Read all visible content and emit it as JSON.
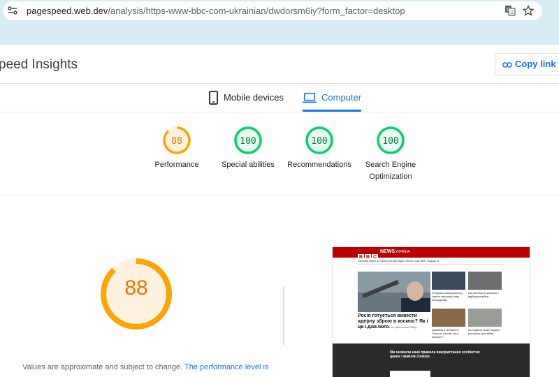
{
  "browser": {
    "url_host": "pagespeed.web.dev",
    "url_path": "/analysis/https-www-bbc-com-ukrainian/dwdorsm6iy?form_factor=desktop",
    "icons": [
      "site-info-icon",
      "translate-icon",
      "star-icon"
    ]
  },
  "header": {
    "title": "peed Insights",
    "copy_link_label": "Copy link"
  },
  "tabs": [
    {
      "label": "Mobile devices",
      "icon": "phone-icon",
      "active": false
    },
    {
      "label": "Computer",
      "icon": "laptop-icon",
      "active": true
    }
  ],
  "scores": [
    {
      "value": "88",
      "label": "Performance",
      "status": "average",
      "color": "#e67700",
      "ring": "#ffa400",
      "fraction": 0.88
    },
    {
      "value": "100",
      "label": "Special abilities",
      "status": "good",
      "color": "#0c7a3e",
      "ring": "#0cce6b",
      "fraction": 1.0
    },
    {
      "value": "100",
      "label": "Recommendations",
      "status": "good",
      "color": "#0c7a3e",
      "ring": "#0cce6b",
      "fraction": 1.0
    },
    {
      "value": "100",
      "label": "Search Engine Optimization",
      "status": "good",
      "color": "#0c7a3e",
      "ring": "#0cce6b",
      "fraction": 1.0
    }
  ],
  "performance": {
    "score": "88",
    "fraction": 0.88,
    "note_text": "Values are approximate and subject to change.",
    "note_link": "The performance level is"
  },
  "thumbnail": {
    "brand": [
      "B",
      "B",
      "C"
    ],
    "news": "NEWS",
    "edition": "УКРАЇНА",
    "nav": "Головна   Війна в Україні   Історії   Відео   Книги року ВВС   Подкасти",
    "headline": "Росія готується вивести ядерну зброю в космос? Як і це і для чого",
    "sub": "Нове американське Росії та рабочтиної Війну",
    "side1": "Російська авіаурагала у Ізраїлі загрожує нову Баладынам",
    "side2": "Автомобіль в шматках і відбулися війни...",
    "side3": "Авіабаза у Фенвичні: \"Більше тижнів, кіж у Бахмут?\"",
    "side4": "Як Україна може подати допомогу для війни",
    "cookie_title": "Ми оновили наші правила використання особистих даних і файлів cookies"
  }
}
